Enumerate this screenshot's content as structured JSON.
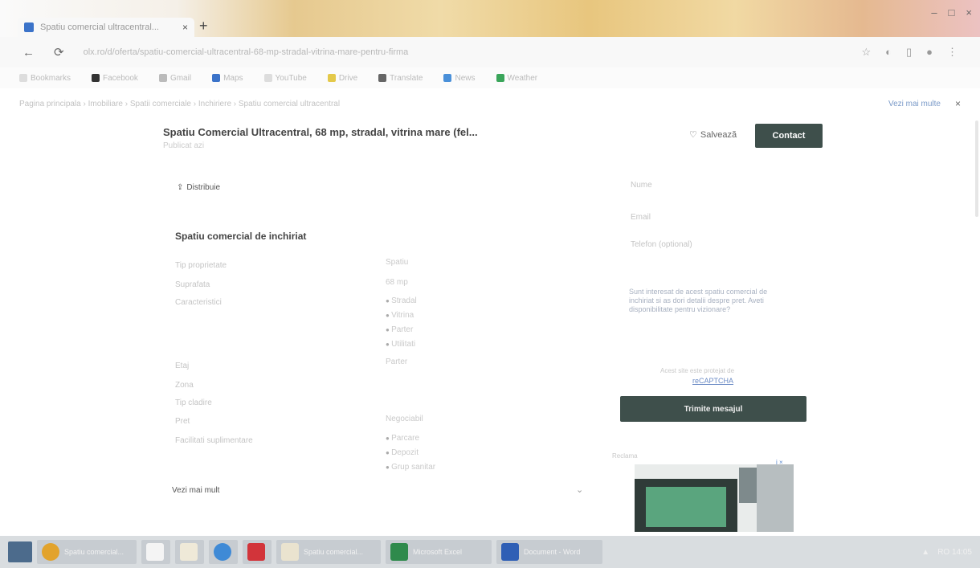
{
  "browser": {
    "tab_title": "Spatiu comercial ultracentral...",
    "tab_close": "×",
    "new_tab": "+",
    "url": "olx.ro/d/oferta/spatiu-comercial-ultracentral-68-mp-stradal-vitrina-mare-pentru-firma",
    "window_controls": [
      "–",
      "□",
      "×"
    ],
    "bookmarks": [
      "Bookmarks",
      "Facebook",
      "Gmail",
      "Maps",
      "YouTube",
      "Drive",
      "Translate",
      "News",
      "Weather"
    ]
  },
  "breadcrumb": {
    "path": "Pagina principala › Imobiliare › Spatii comerciale › Inchiriere › Spatiu comercial ultracentral",
    "link": "Vezi mai multe"
  },
  "listing": {
    "title": "Spatiu Comercial Ultracentral, 68 mp, stradal, vitrina mare (fel...",
    "subtitle": "Publicat azi",
    "save_label": "Salvează",
    "contact_label": "Contact",
    "share_label": "Distribuie"
  },
  "details": {
    "heading": "Spatiu comercial de inchiriat",
    "rows": [
      {
        "label": "Tip proprietate",
        "value": "Spatiu"
      },
      {
        "label": "Suprafata",
        "value": "68 mp"
      },
      {
        "label": "Caracteristici",
        "values": [
          "Stradal",
          "Vitrina",
          "Parter",
          "Utilitati"
        ]
      },
      {
        "label": "Etaj",
        "value": "Parter"
      },
      {
        "label": "Zona",
        "value": ""
      },
      {
        "label": "Tip cladire",
        "value": ""
      },
      {
        "label": "Pret",
        "value": "Negociabil"
      },
      {
        "label": "Facilitati suplimentare",
        "values": [
          "Parcare",
          "Depozit",
          "Grup sanitar"
        ]
      }
    ],
    "more_label": "Vezi mai mult"
  },
  "contact_form": {
    "name_placeholder": "Nume",
    "email_placeholder": "Email",
    "phone_placeholder": "Telefon (optional)",
    "message": "Sunt interesat de acest spatiu comercial de inchiriat si as dori detalii despre pret. Aveti disponibilitate pentru vizionare?",
    "captcha_note": "Acest site este protejat de",
    "captcha_link": "reCAPTCHA",
    "send_label": "Trimite mesajul",
    "ad_label": "Reclama",
    "ad_badge": "i ×"
  },
  "taskbar": {
    "items": [
      "Spatiu comercial...",
      "Acasa",
      "Documente",
      "Edge",
      "Adobe",
      "Spatiu comercial...",
      "Microsoft Excel",
      "Document - Word"
    ],
    "tray": "RO 14:05"
  },
  "colors": {
    "accent_button": "#3e4f4b",
    "link": "#6a8ac4"
  }
}
